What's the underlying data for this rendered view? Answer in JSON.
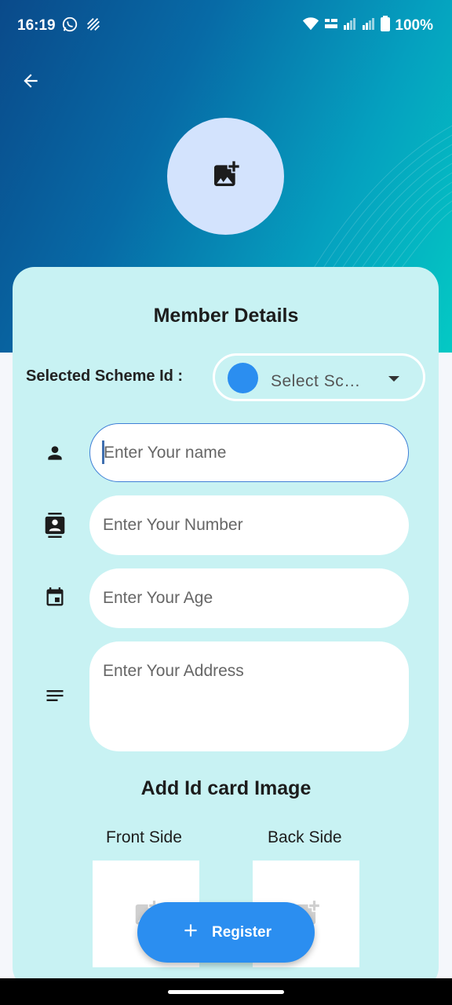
{
  "status_bar": {
    "time": "16:19",
    "battery": "100%",
    "icons": [
      "whatsapp-icon",
      "signal-strike-icon",
      "wifi-icon",
      "lte-icon",
      "cell-signal-icon",
      "cell-signal-icon",
      "battery-icon"
    ]
  },
  "header": {
    "back_icon": "arrow-back-icon",
    "avatar_icon": "add-photo-icon"
  },
  "card": {
    "title": "Member Details",
    "scheme_label": "Selected Scheme Id :",
    "scheme_select_text": "Select Sc…",
    "fields": [
      {
        "icon": "person-icon",
        "placeholder": "Enter Your name"
      },
      {
        "icon": "contact-card-icon",
        "placeholder": "Enter Your Number"
      },
      {
        "icon": "calendar-icon",
        "placeholder": "Enter Your Age"
      },
      {
        "icon": "notes-icon",
        "placeholder": "Enter Your Address"
      }
    ],
    "id_section_title": "Add Id card Image",
    "front_label": "Front Side",
    "back_label": "Back Side"
  },
  "register_button": {
    "label": "Register",
    "icon": "plus-icon"
  },
  "colors": {
    "accent": "#2b8ef0",
    "card_bg": "#c8f2f3",
    "avatar_bg": "#d3e3fd"
  }
}
